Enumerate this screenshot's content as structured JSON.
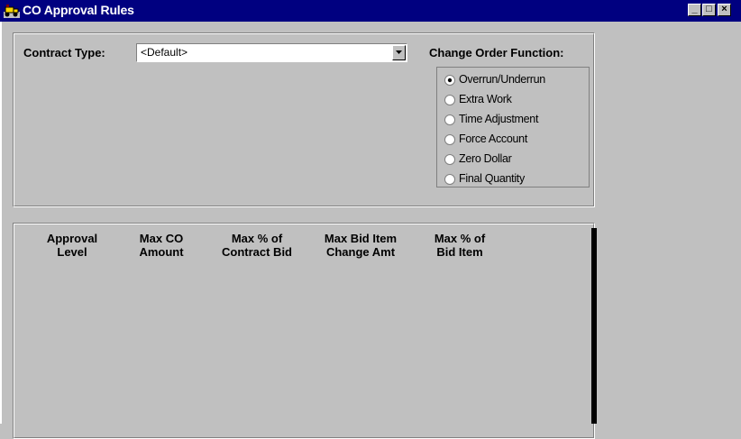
{
  "window": {
    "title": "CO Approval Rules",
    "controls": {
      "minimize": "_",
      "maximize": "□",
      "close": "×"
    }
  },
  "filters": {
    "contract_type_label": "Contract Type:",
    "contract_type_value": "<Default>",
    "change_order_function_label": "Change Order Function:",
    "change_order_functions": [
      {
        "label": "Overrun/Underrun",
        "selected": true
      },
      {
        "label": "Extra Work",
        "selected": false
      },
      {
        "label": "Time Adjustment",
        "selected": false
      },
      {
        "label": "Force Account",
        "selected": false
      },
      {
        "label": "Zero Dollar",
        "selected": false
      },
      {
        "label": "Final Quantity",
        "selected": false
      }
    ]
  },
  "grid": {
    "columns": [
      {
        "line1": "Approval",
        "line2": "Level"
      },
      {
        "line1": "Max CO",
        "line2": "Amount"
      },
      {
        "line1": "Max % of",
        "line2": "Contract Bid"
      },
      {
        "line1": "Max Bid Item",
        "line2": "Change Amt"
      },
      {
        "line1": "Max % of",
        "line2": "Bid Item"
      }
    ],
    "rows": []
  }
}
